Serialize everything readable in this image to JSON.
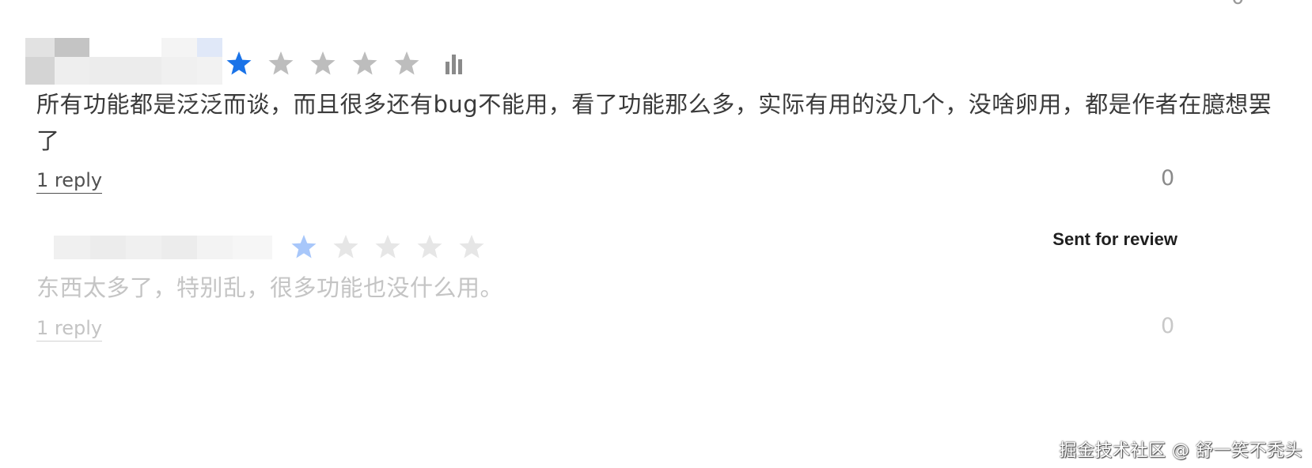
{
  "previous_review": {
    "like_count": "0"
  },
  "reviews": [
    {
      "rating": 1,
      "max_rating": 5,
      "text": "所有功能都是泛泛而谈，而且很多还有bug不能用，看了功能那么多，实际有用的没几个，没啥卵用，都是作者在臆想罢了",
      "reply_label": "1 reply",
      "like_count": "0",
      "status": "",
      "icons": {
        "star_filled": "star-filled-icon",
        "star_empty": "star-empty-icon",
        "stats": "bar-chart-icon"
      }
    },
    {
      "rating": 1,
      "max_rating": 5,
      "text": "东西太多了，特别乱，很多功能也没什么用。",
      "reply_label": "1 reply",
      "like_count": "0",
      "status": "Sent for review",
      "icons": {
        "star_filled": "star-filled-icon",
        "star_empty": "star-empty-icon"
      }
    }
  ],
  "colors": {
    "star_active": "#1a73e8",
    "star_active_faded": "#a8c7fa",
    "star_inactive": "#bdbdbd",
    "star_inactive_faded": "#e6e6e6",
    "text_primary": "#3a3a3a",
    "text_faded": "#c4c4c4"
  },
  "watermark": "掘金技术社区 @ 舒一笑不秃头"
}
